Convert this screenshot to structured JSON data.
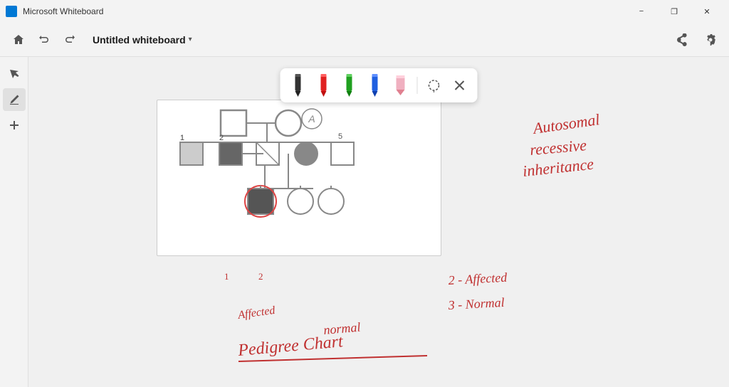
{
  "titlebar": {
    "app_name": "Microsoft Whiteboard",
    "minimize_label": "−",
    "maximize_label": "❐",
    "close_label": "✕"
  },
  "toolbar": {
    "undo_label": "↩",
    "redo_label": "↪",
    "whiteboard_name": "Untitled whiteboard",
    "chevron": "∨",
    "share_label": "⎙",
    "settings_label": "⚙"
  },
  "sidebar": {
    "select_label": "↖",
    "pen_label": "✏",
    "add_label": "+"
  },
  "pen_toolbar": {
    "lasso_label": "⊙",
    "close_label": "✕"
  },
  "pens": [
    {
      "id": "pen-black",
      "color": "black",
      "label": "Black pen"
    },
    {
      "id": "pen-red",
      "color": "red",
      "label": "Red pen"
    },
    {
      "id": "pen-green",
      "color": "green",
      "label": "Green pen"
    },
    {
      "id": "pen-blue",
      "color": "blue",
      "label": "Blue pen"
    },
    {
      "id": "pen-pink",
      "color": "pink",
      "label": "Pink highlighter"
    }
  ],
  "annotations": {
    "title": "Autosomal recessive inheritance",
    "label1": "Pedigree Chart",
    "label2": "2 - Affected",
    "label3": "3 - Normal",
    "label4": "normal",
    "label5": "Affected"
  }
}
